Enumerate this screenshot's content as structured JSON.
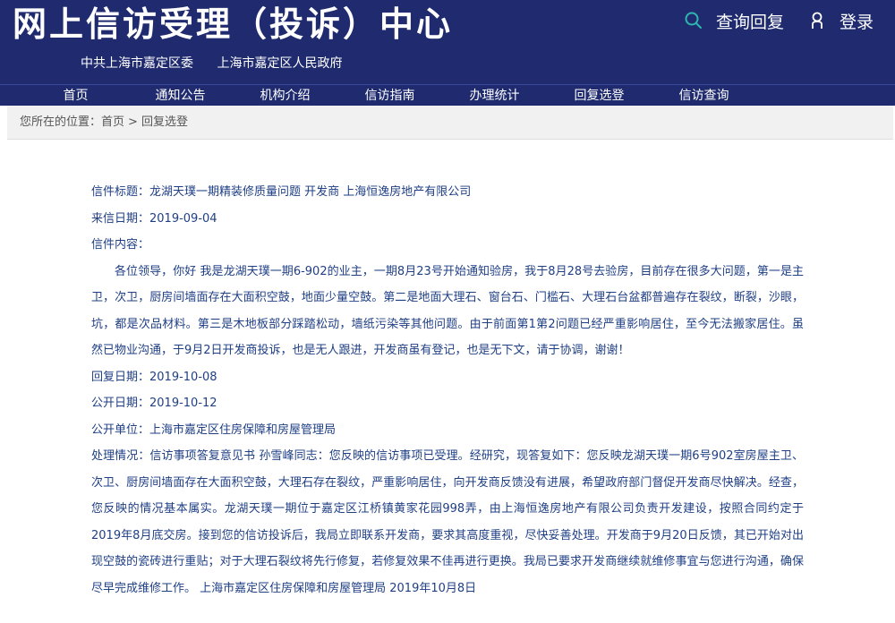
{
  "header": {
    "site_title": "网上信访受理（投诉）中心",
    "org1": "中共上海市嘉定区委",
    "org2": "上海市嘉定区人民政府",
    "query_label": "查询回复",
    "login_label": "登录",
    "search_icon": "search-icon",
    "user_icon": "user-icon"
  },
  "nav": {
    "items": [
      "首页",
      "通知公告",
      "机构介绍",
      "信访指南",
      "办理统计",
      "回复选登",
      "信访查询"
    ]
  },
  "breadcrumb": {
    "prefix": "您所在的位置：",
    "home": "首页",
    "separator": ">",
    "current": "回复选登"
  },
  "letter": {
    "title_label": "信件标题：",
    "title": "龙湖天璞一期精装修质量问题 开发商 上海恒逸房地产有限公司",
    "date_label": "来信日期：",
    "date": "2019-09-04",
    "content_label": "信件内容：",
    "content": "各位领导，你好 我是龙湖天璞一期6-902的业主，一期8月23号开始通知验房，我于8月28号去验房，目前存在很多大问题，第一是主卫，次卫，厨房间墙面存在大面积空鼓，地面少量空鼓。第二是地面大理石、窗台石、门槛石、大理石台盆都普遍存在裂纹，断裂，沙眼，坑，都是次品材料。第三是木地板部分踩踏松动，墙纸污染等其他问题。由于前面第1第2问题已经严重影响居住，至今无法搬家居住。虽然已物业沟通，于9月2日开发商投诉，也是无人跟进，开发商虽有登记，也是无下文，请于协调，谢谢！",
    "reply_date_label": "回复日期：",
    "reply_date": "2019-10-08",
    "publish_date_label": "公开日期：",
    "publish_date": "2019-10-12",
    "unit_label": "公开单位：",
    "unit": "上海市嘉定区住房保障和房屋管理局",
    "handling_label": "处理情况：",
    "handling": "信访事项答复意见书 孙雪峰同志：您反映的信访事项已受理。经研究，现答复如下：您反映龙湖天璞一期6号902室房屋主卫、次卫、厨房间墙面存在大面积空鼓，大理石存在裂纹，严重影响居住，向开发商反馈没有进展，希望政府部门督促开发商尽快解决。经查，您反映的情况基本属实。龙湖天璞一期位于嘉定区江桥镇黄家花园998弄，由上海恒逸房地产有限公司负责开发建设，按照合同约定于2019年8月底交房。接到您的信访投诉后，我局立即联系开发商，要求其高度重视，尽快妥善处理。开发商于9月20日反馈，其已开始对出现空鼓的瓷砖进行重贴；对于大理石裂纹将先行修复，若修复效果不佳再进行更换。我局已要求开发商继续就维修事宜与您进行沟通，确保尽早完成维修工作。 上海市嘉定区住房保障和房屋管理局 2019年10月8日"
  },
  "colors": {
    "header_bg": "#1f2b6e",
    "text_blue": "#1f3f85",
    "breadcrumb_bg": "#f1f1f1"
  }
}
